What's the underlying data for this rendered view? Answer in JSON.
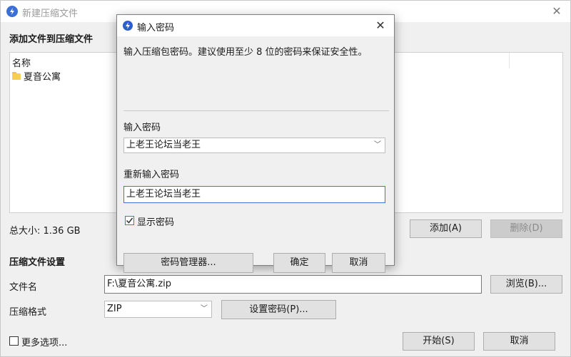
{
  "main_window": {
    "title": "新建压缩文件",
    "close_glyph": "✕",
    "section_add": "添加文件到压缩文件",
    "file_list": {
      "column_header": "名称",
      "items": [
        {
          "name": "夏音公寓",
          "icon": "folder-icon"
        }
      ]
    },
    "total_size": "总大小: 1.36 GB",
    "add_button": "添加(A)",
    "remove_button": "删除(D)",
    "section_settings": "压缩文件设置",
    "filename_label": "文件名",
    "filename_value": "F:\\夏音公寓.zip",
    "browse_button": "浏览(B)...",
    "format_label": "压缩格式",
    "format_value": "ZIP",
    "set_password_button": "设置密码(P)...",
    "more_options_label": "更多选项...",
    "start_button": "开始(S)",
    "cancel_button": "取消"
  },
  "password_dialog": {
    "title": "输入密码",
    "close_glyph": "✕",
    "hint": "输入压缩包密码。建议使用至少 8 位的密码来保证安全性。",
    "password_label": "输入密码",
    "password_value": "上老王论坛当老王",
    "confirm_label": "重新输入密码",
    "confirm_value": "上老王论坛当老王",
    "show_password_label": "显示密码",
    "show_password_checked": true,
    "manager_button": "密码管理器...",
    "ok_button": "确定",
    "cancel_button": "取消"
  },
  "colors": {
    "accent": "#3a78d2",
    "window_bg": "#f0f0f0",
    "button_bg": "#e1e1e1",
    "disabled_text": "#8a8a8a",
    "app_icon": "#2c5fc9"
  }
}
